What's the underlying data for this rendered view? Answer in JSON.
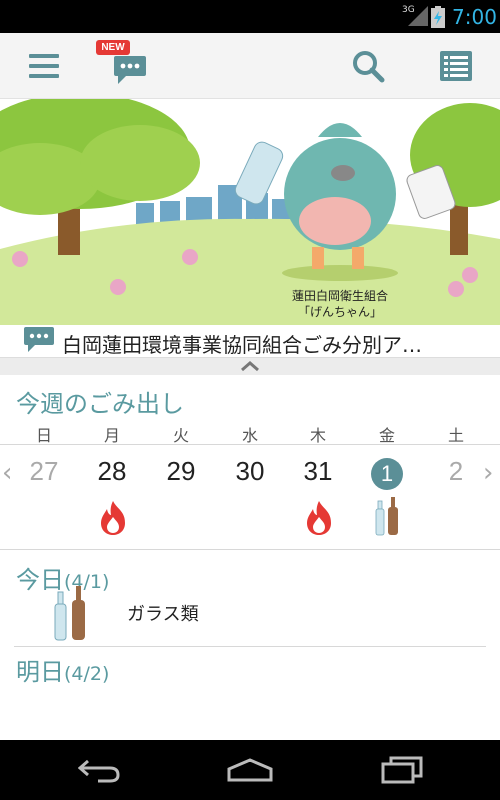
{
  "status_bar": {
    "network": "3G",
    "time": "7:00"
  },
  "action_bar": {
    "new_badge": "NEW",
    "icons": [
      "menu-icon",
      "chat-icon",
      "search-icon",
      "list-icon"
    ],
    "accent_color": "#5b8f97"
  },
  "banner": {
    "org_name": "蓮田白岡衛生組合",
    "mascot_name": "「げんちゃん」"
  },
  "news": {
    "text": "白岡蓮田環境事業協同組合ごみ分別ア…"
  },
  "week": {
    "title": "今週のごみ出し",
    "days_of_week": [
      "日",
      "月",
      "火",
      "水",
      "木",
      "金",
      "土"
    ],
    "dates": [
      "27",
      "28",
      "29",
      "30",
      "31",
      "1",
      "2"
    ],
    "today_index": 5,
    "icons": {
      "mon": "burnable-fire-icon",
      "thu": "burnable-fire-icon",
      "fri": "glass-bottles-icon"
    }
  },
  "today": {
    "label": "今日",
    "date": "(4/1)",
    "item": "ガラス類",
    "icon": "glass-bottles-icon"
  },
  "tomorrow": {
    "label": "明日",
    "date": "(4/2)"
  },
  "colors": {
    "fire": "#e53935",
    "section": "#5a9aa0",
    "brand_red": "#e53935"
  }
}
